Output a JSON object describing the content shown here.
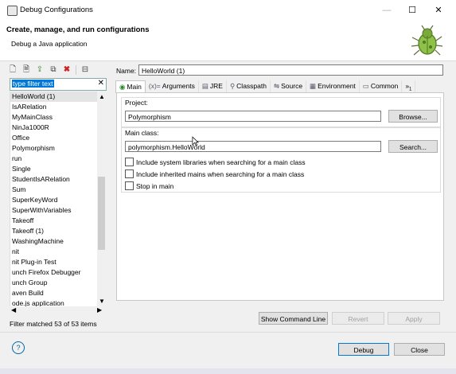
{
  "window": {
    "title": "Debug Configurations",
    "minimize": "—",
    "maximize": "☐",
    "close": "✕"
  },
  "header": {
    "title": "Create, manage, and run configurations",
    "subtitle": "Debug a Java application"
  },
  "left": {
    "filter_text": "type filter text",
    "items": [
      "HelloWorld (1)",
      "IsARelation",
      "MyMainClass",
      "NinJa1000R",
      "Office",
      "Polymorphism",
      "run",
      "Single",
      "StudentIsARelation",
      "Sum",
      "SuperKeyWord",
      "SuperWithVariables",
      "Takeoff",
      "Takeoff (1)",
      "WashingMachine",
      "nit",
      "nit Plug-in Test",
      "unch Firefox Debugger",
      "unch Group",
      "aven Build",
      "ode.js application"
    ],
    "status": "Filter matched 53 of 53 items"
  },
  "form": {
    "name_label": "Name:",
    "name_value": "HelloWorld (1)",
    "tabs": [
      "Main",
      "Arguments",
      "JRE",
      "Classpath",
      "Source",
      "Environment",
      "Common",
      "»"
    ],
    "tabs_overflow_count": "1",
    "project_label": "Project:",
    "project_value": "Polymorphism",
    "browse_label": "Browse...",
    "mainclass_label": "Main class:",
    "mainclass_value": "polymorphism.HelloWorld",
    "search_label": "Search...",
    "checkboxes": [
      "Include system libraries when searching for a main class",
      "Include inherited mains when searching for a main class",
      "Stop in main"
    ],
    "show_cmd_label": "Show Command Line",
    "revert_label": "Revert",
    "apply_label": "Apply"
  },
  "footer": {
    "help": "?",
    "debug_label": "Debug",
    "close_label": "Close"
  }
}
